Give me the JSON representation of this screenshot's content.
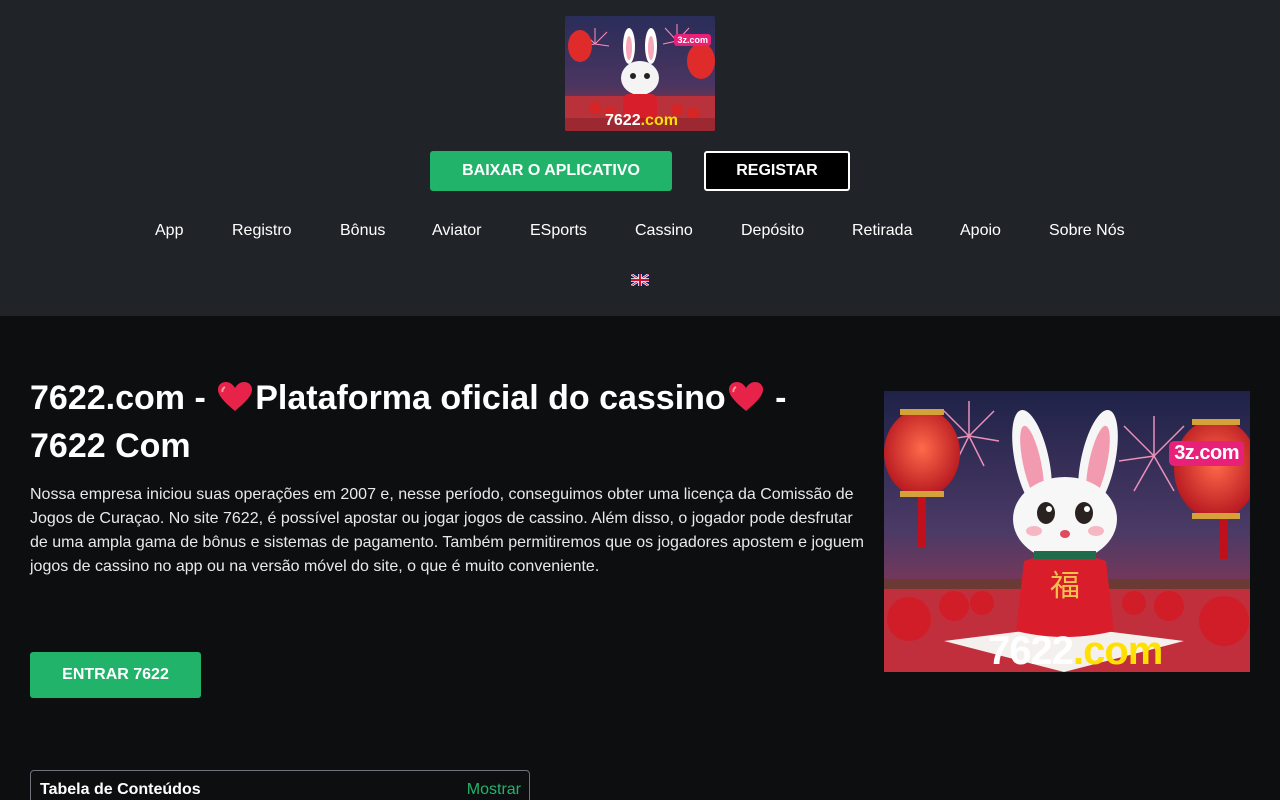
{
  "header": {
    "download_label": "BAIXAR O APLICATIVO",
    "register_label": "REGISTAR",
    "logo": {
      "badge": "3z.com",
      "site_prefix": "7622",
      "site_suffix": ".com"
    },
    "nav": [
      "App",
      "Registro",
      "Bônus",
      "Aviator",
      "ESports",
      "Cassino",
      "Depósito",
      "Retirada",
      "Apoio",
      "Sobre Nós"
    ],
    "language_icon": "uk-flag-icon"
  },
  "main": {
    "title_part1": "7622.com - ",
    "title_part2": "Plataforma oficial do cassino",
    "title_part3": " - 7622 Com",
    "intro": "Nossa empresa iniciou suas operações em 2007 e, nesse período, conseguimos obter uma licença da Comissão de Jogos de Curaçao. No site 7622, é possível apostar ou jogar jogos de cassino. Além disso, o jogador pode desfrutar de uma ampla gama de bônus e sistemas de pagamento. Também permitiremos que os jogadores apostem e joguem jogos de cassino no app ou na versão móvel do site, o que é muito conveniente.",
    "enter_label": "ENTRAR 7622",
    "hero": {
      "badge": "3z.com",
      "site_prefix": "7622",
      "site_suffix": ".com",
      "glyph": "福"
    }
  },
  "toc": {
    "title": "Tabela de Conteúdos",
    "toggle": "Mostrar"
  },
  "colors": {
    "accent": "#22b36b",
    "header_bg": "#202328",
    "page_bg": "#0d0e10"
  }
}
